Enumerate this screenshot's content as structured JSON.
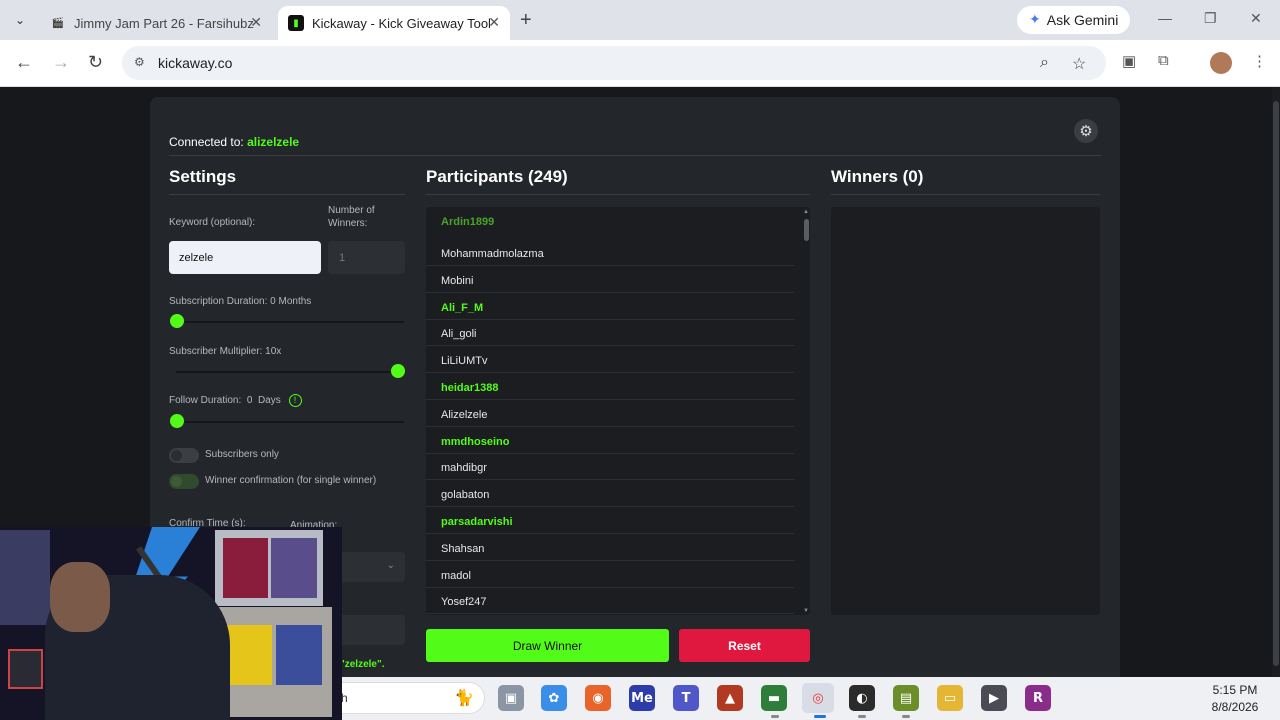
{
  "browser": {
    "tabs": [
      {
        "label": "Jimmy Jam Part 26 - Farsihubz",
        "active": false,
        "icon": "clapper-icon"
      },
      {
        "label": "Kickaway - Kick Giveaway Tool",
        "active": true,
        "icon": "kickaway-favicon"
      }
    ],
    "ask_gemini": "Ask Gemini",
    "url": "kickaway.co"
  },
  "app": {
    "connected_prefix": "Connected to:",
    "connected_user": "alizelzele",
    "settings": {
      "title": "Settings",
      "keyword_label": "Keyword (optional):",
      "keyword_value": "zelzele",
      "num_winners_label": "Number of Winners:",
      "num_winners_value": "1",
      "sub_duration_label": "Subscription Duration: 0 Months",
      "sub_duration_value": 0,
      "sub_multiplier_label": "Subscriber Multiplier: 10x",
      "sub_multiplier_fraction": 1.0,
      "follow_duration_label": "Follow Duration:",
      "follow_duration_value": "0",
      "follow_duration_unit": "Days",
      "follow_duration_info": "!",
      "subscribers_only_label": "Subscribers only",
      "winner_confirmation_label": "Winner confirmation (for single winner)",
      "confirm_time_label": "Confirm Time (s):",
      "animation_label": "Animation:",
      "keyword_hint": "\"zelzele\"."
    },
    "participants": {
      "title": "Participants (249)",
      "items": [
        {
          "name": "Ardin1899",
          "style": "dimgreen"
        },
        {
          "name": "Mohammadmolazma",
          "style": "normal"
        },
        {
          "name": "Mobini",
          "style": "normal"
        },
        {
          "name": "Ali_F_M",
          "style": "green"
        },
        {
          "name": "Ali_goli",
          "style": "normal"
        },
        {
          "name": "LiLiUMTv",
          "style": "normal"
        },
        {
          "name": "heidar1388",
          "style": "green"
        },
        {
          "name": "Alizelzele",
          "style": "normal"
        },
        {
          "name": "mmdhoseino",
          "style": "green"
        },
        {
          "name": "mahdibgr",
          "style": "normal"
        },
        {
          "name": "golabaton",
          "style": "normal"
        },
        {
          "name": "parsadarvishi",
          "style": "green"
        },
        {
          "name": "Shahsan",
          "style": "normal"
        },
        {
          "name": "madol",
          "style": "normal"
        },
        {
          "name": "Yosef247",
          "style": "normal"
        }
      ]
    },
    "winners": {
      "title": "Winners (0)"
    },
    "draw_label": "Draw Winner",
    "reset_label": "Reset"
  },
  "taskbar": {
    "search_partial": "h",
    "time": "5:15 PM",
    "date": "8/8/2026"
  },
  "colors": {
    "kick_green": "#53fc18",
    "reset_red": "#e0173f",
    "card_bg": "#23262a"
  }
}
